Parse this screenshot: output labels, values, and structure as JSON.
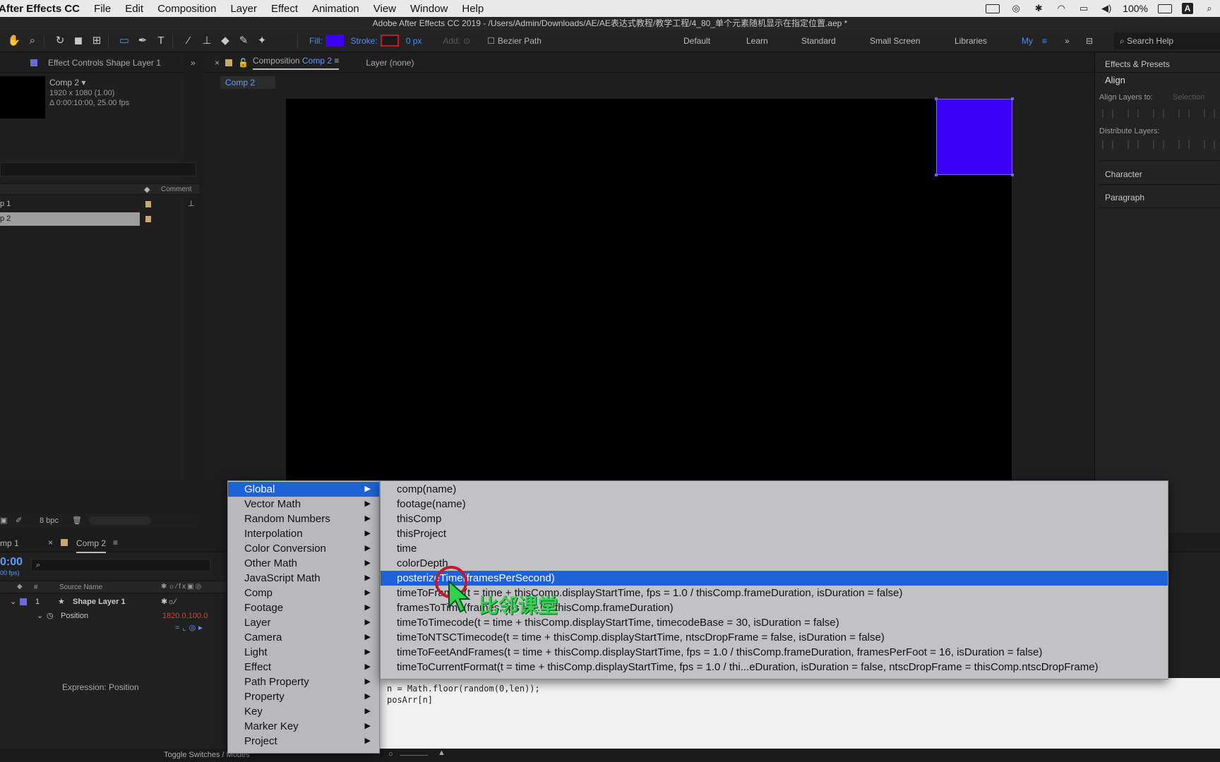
{
  "menubar": {
    "app_name": "After Effects CC",
    "items": [
      "File",
      "Edit",
      "Composition",
      "Layer",
      "Effect",
      "Animation",
      "View",
      "Window",
      "Help"
    ],
    "battery": "100%",
    "input_source": "A"
  },
  "window_title": "Adobe After Effects CC 2019 - /Users/Admin/Downloads/AE/AE表达式教程/教学工程/4_80_单个元素随机显示在指定位置.aep *",
  "toolbar": {
    "fill_label": "Fill:",
    "stroke_label": "Stroke:",
    "stroke_width": "0 px",
    "add_label": "Add:",
    "bezier_label": "Bezier Path",
    "fill_color": "#3c00f7",
    "stroke_color": "#c31a2a",
    "workspaces": [
      "Default",
      "Learn",
      "Standard",
      "Small Screen",
      "Libraries",
      "My"
    ],
    "search_placeholder": "Search Help"
  },
  "left_panel": {
    "tab_label": "Effect Controls Shape Layer 1",
    "comp_name": "Comp 2 ▾",
    "comp_size": "1920 x 1080 (1.00)",
    "comp_duration": "Δ 0:00:10:00, 25.00 fps",
    "comment_header": "Comment",
    "items": [
      {
        "name": "p 1"
      },
      {
        "name": "p 2"
      }
    ],
    "bpc": "8 bpc"
  },
  "comp_panel": {
    "tab_prefix": "Composition",
    "tab_comp": "Comp 2",
    "layer_tab": "Layer (none)",
    "subtab": "Comp 2"
  },
  "right_panel": {
    "effects_presets": "Effects & Presets",
    "align": "Align",
    "align_layers_to": "Align Layers to:",
    "align_target": "Selection",
    "distribute_layers": "Distribute Layers:",
    "character": "Character",
    "paragraph": "Paragraph"
  },
  "timeline": {
    "tab_1": "mp 1",
    "tab_2": "Comp 2",
    "timecode": "0:00",
    "fps": "00 fps)",
    "source_name_header": "Source Name",
    "num_header": "#",
    "layer_number": "1",
    "layer_name": "Shape Layer 1",
    "property_name": "Position",
    "property_value": "1820.0,100.0",
    "expression_label": "Expression: Position",
    "expression_lines": [
      "n = Math.floor(random(0,len));",
      "posArr[n]"
    ],
    "toggle_label": "Toggle Switches / Modes"
  },
  "menu_main": {
    "items": [
      "Global",
      "Vector Math",
      "Random Numbers",
      "Interpolation",
      "Color Conversion",
      "Other Math",
      "JavaScript Math",
      "Comp",
      "Footage",
      "Layer",
      "Camera",
      "Light",
      "Effect",
      "Path Property",
      "Property",
      "Key",
      "Marker Key",
      "Project"
    ],
    "selected_index": 0
  },
  "menu_sub": {
    "items": [
      "comp(name)",
      "footage(name)",
      "thisComp",
      "thisProject",
      "time",
      "colorDepth",
      "posterizeTime(framesPerSecond)",
      "timeToFrames(t = time + thisComp.displayStartTime, fps = 1.0 / thisComp.frameDuration, isDuration = false)",
      "framesToTime(frames, fps = 1.0 / thisComp.frameDuration)",
      "timeToTimecode(t = time + thisComp.displayStartTime, timecodeBase = 30, isDuration = false)",
      "timeToNTSCTimecode(t = time + thisComp.displayStartTime, ntscDropFrame = false, isDuration = false)",
      "timeToFeetAndFrames(t = time + thisComp.displayStartTime, fps = 1.0 / thisComp.frameDuration, framesPerFoot = 16, isDuration = false)",
      "timeToCurrentFormat(t = time + thisComp.displayStartTime, fps = 1.0 / thi...eDuration, isDuration = false, ntscDropFrame = thisComp.ntscDropFrame)"
    ],
    "selected_index": 6
  },
  "watermark": "比邻课堂"
}
